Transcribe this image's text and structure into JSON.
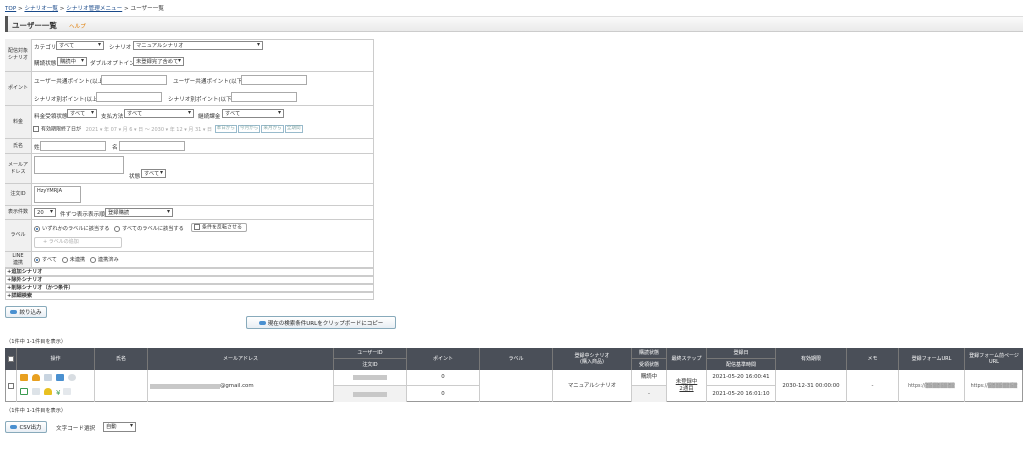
{
  "breadcrumb": {
    "top": "TOP",
    "sep1": " > ",
    "scenario_list": "シナリオ一覧",
    "sep2": " > ",
    "scenario_menu": "シナリオ管理メニュー",
    "sep3": " > ",
    "current": "ユーザー一覧"
  },
  "page": {
    "title": "ユーザー一覧",
    "help": "ヘルプ"
  },
  "search": {
    "target_label": "配信対象シナリオ",
    "category_label": "カテゴリ",
    "category_value": "すべて",
    "scenario_label": "シナリオ",
    "scenario_value": "マニュアルシナリオ",
    "status_label": "購読状態",
    "status_value": "購読中",
    "double_optin_label": "ダブルオプトイン",
    "double_optin_value": "未登録完了含めて",
    "point_label": "ポイント",
    "user_point_min": "ユーザー共通ポイント(以上)",
    "user_point_max": "ユーザー共通ポイント(以下)",
    "scenario_point_min": "シナリオ別ポイント(以上)",
    "scenario_point_max": "シナリオ別ポイント(以下)",
    "fee_label": "料金",
    "fee_status_label": "料金受領状態",
    "fee_status_value": "すべて",
    "pay_method_label": "支払方法",
    "pay_method_value": "すべて",
    "continuous_label": "継続課金",
    "continuous_value": "すべて",
    "period_end_label": "有効期限終了日が",
    "date_from": "2021 ▾ 年 07 ▾ 月 6 ▾ 日  〜  2030 ▾ 年 12 ▾ 月 31 ▾ 日",
    "date_btns": [
      "本日から",
      "今月から",
      "来月から",
      "全期間"
    ],
    "name_label": "氏名",
    "sei_label": "姓",
    "mei_label": "名",
    "email_label": "メールアドレス",
    "email_state_label": "状態",
    "email_state_value": "すべて",
    "order_label": "注文ID",
    "order_value": "HzyYMRJA",
    "per_page_label": "表示件数",
    "per_page_value": "20",
    "per_page_suffix": "件ずつ表示",
    "order_by_label": "表示順",
    "order_by_value": "登録購読",
    "label_label": "ラベル",
    "label_any": "いずれかのラベルに該当する",
    "label_all": "すべてのラベルに該当する",
    "label_invert": "条件を反転させる",
    "label_add": "+ ラベルの追加",
    "line_label": "LINE連携",
    "line_all": "すべて",
    "line_no": "未連携",
    "line_yes": "連携済み",
    "acc": [
      "+追加シナリオ",
      "+除外シナリオ",
      "+削除シナリオ（かつ条件）",
      "+詳細検索"
    ],
    "search_button": "絞り込み",
    "copy_button": "現在の検索条件URLをクリップボードにコピー"
  },
  "results": {
    "count_top": "（1件中 1-1件目を表示）",
    "count_bottom": "（1件中 1-1件目を表示）"
  },
  "table": {
    "headers": {
      "ops": "操作",
      "name": "氏名",
      "email": "メールアドレス",
      "user_id": "ユーザーID",
      "order_id": "注文ID",
      "point": "ポイント",
      "label": "ラベル",
      "scenario": "登録中シナリオ\n(購入商品)",
      "status1": "購読状態",
      "status2": "受領状態",
      "step": "最終ステップ",
      "reg_date": "登録日",
      "send_date": "配信基準時間",
      "expire": "有効期限",
      "memo": "メモ",
      "form_url": "登録フォームURL",
      "form_prev_url": "登録フォーム前ページURL"
    },
    "row": {
      "email": "@gmail.com",
      "point1": "0",
      "point2": "0",
      "scenario": "マニュアルシナリオ",
      "status1": "購読中",
      "status2": "-",
      "step1": "未登録中",
      "step2": "2通目",
      "reg_date": "2021-05-20 16:00:41",
      "send_date": "2021-05-20 16:01:10",
      "expire": "2030-12-31 00:00:00",
      "memo": "-",
      "form_url": "https://▒▒▒▒▒▒▒▒",
      "form_prev_url": "https://▒▒▒▒▒▒▒▒"
    }
  },
  "csv": {
    "button": "CSV出力",
    "charset_label": "文字コード選択",
    "charset_value": "自動"
  },
  "colors": {
    "header_bg": "#4a4f58",
    "accent": "#e07b00",
    "link": "#1a4a8a"
  }
}
